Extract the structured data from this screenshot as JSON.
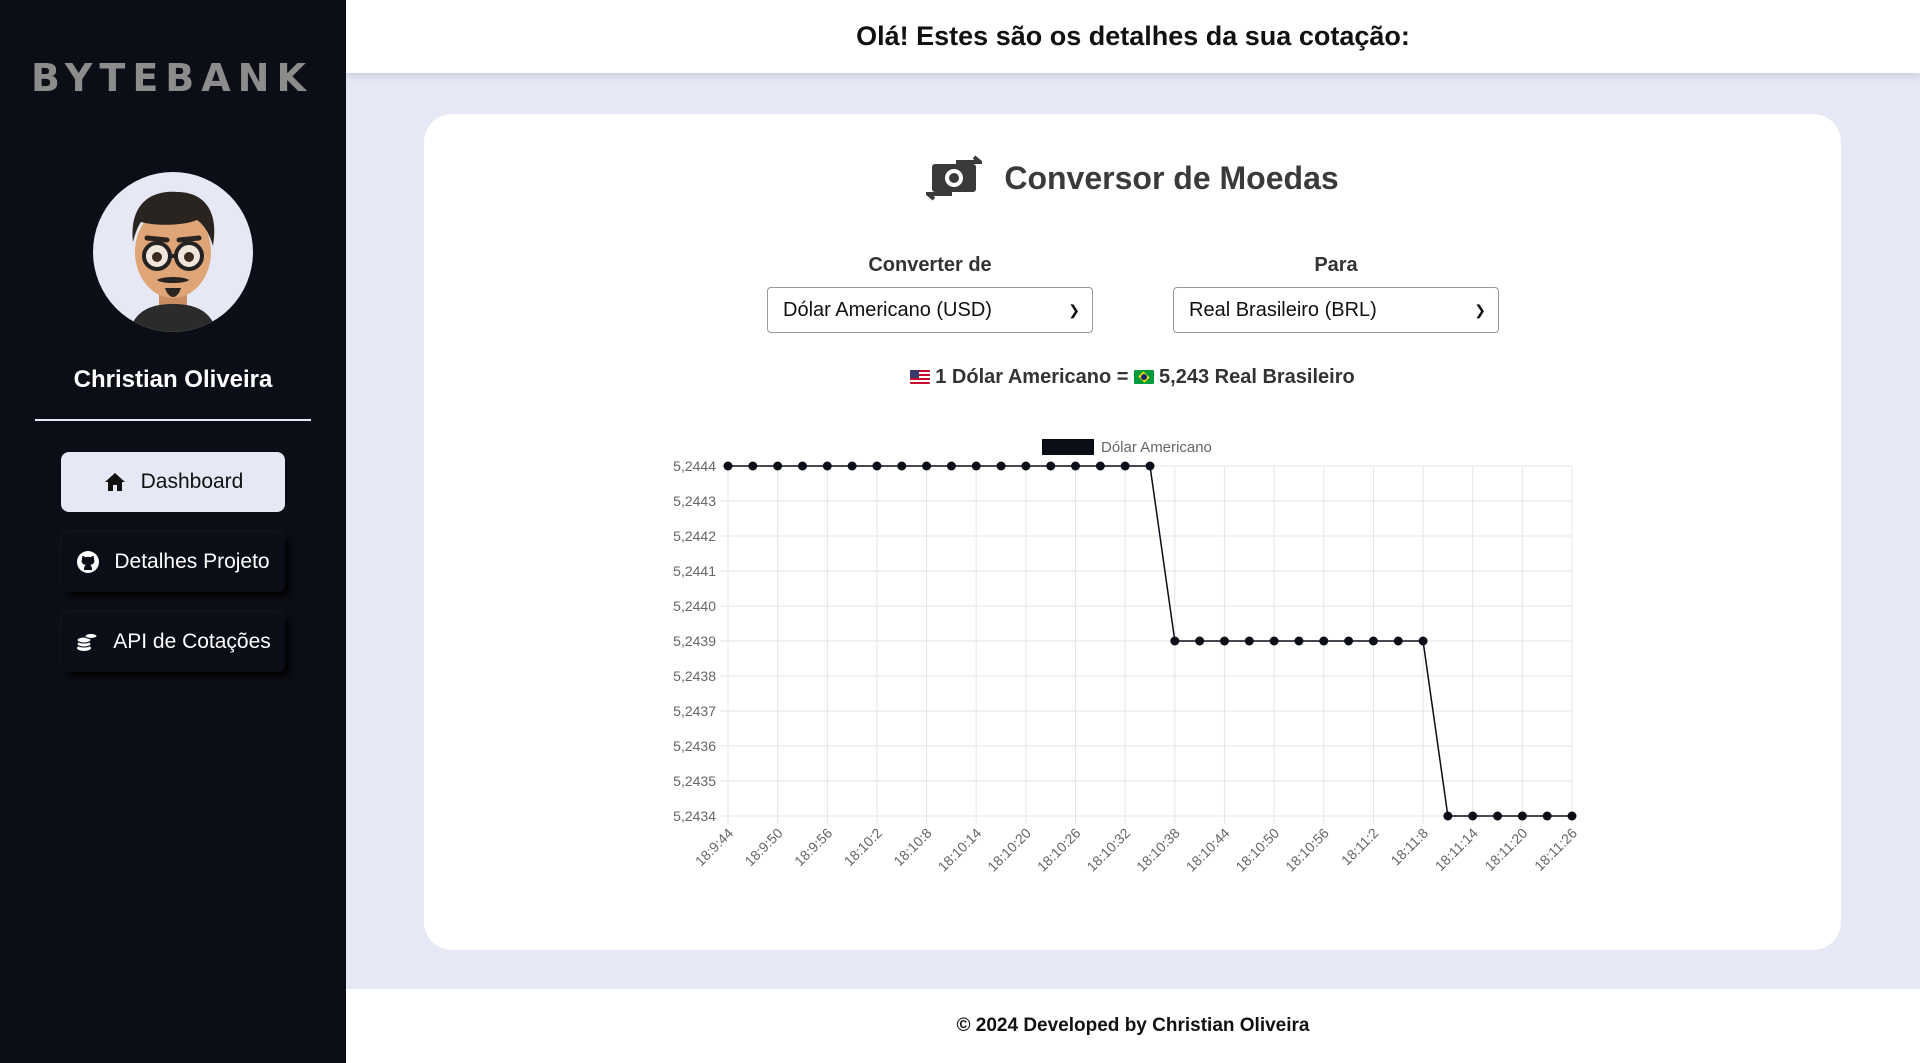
{
  "sidebar": {
    "logo_text": "BYTEBANK",
    "user_name": "Christian Oliveira",
    "nav": [
      {
        "label": "Dashboard",
        "icon": "home-icon"
      },
      {
        "label": "Detalhes Projeto",
        "icon": "github-icon"
      },
      {
        "label": "API de Cotações",
        "icon": "coins-icon"
      }
    ]
  },
  "header": {
    "title": "Olá! Estes são os detalhes da sua cotação:"
  },
  "converter": {
    "title": "Conversor de Moedas",
    "from_label": "Converter de",
    "from_value": "Dólar Americano (USD)",
    "to_label": "Para",
    "to_value": "Real Brasileiro (BRL)",
    "rate_left": "1 Dólar Americano =",
    "rate_right": "5,243 Real Brasileiro"
  },
  "chart_data": {
    "type": "line",
    "legend": "Dólar Americano",
    "legend_placement": "top-center",
    "grid": true,
    "ylim": [
      5.2434,
      5.2444
    ],
    "y_ticks": [
      "5,2444",
      "5,2443",
      "5,2442",
      "5,2441",
      "5,2440",
      "5,2439",
      "5,2438",
      "5,2437",
      "5,2436",
      "5,2435",
      "5,2434"
    ],
    "x_ticks": [
      "18:9:44",
      "18:9:50",
      "18:9:56",
      "18:10:2",
      "18:10:8",
      "18:10:14",
      "18:10:20",
      "18:10:26",
      "18:10:32",
      "18:10:38",
      "18:10:44",
      "18:10:50",
      "18:10:56",
      "18:11:2",
      "18:11:8",
      "18:11:14",
      "18:11:20",
      "18:11:26"
    ],
    "values": [
      5.2444,
      5.2444,
      5.2444,
      5.2444,
      5.2444,
      5.2444,
      5.2444,
      5.2444,
      5.2444,
      5.2444,
      5.2444,
      5.2444,
      5.2444,
      5.2444,
      5.2444,
      5.2444,
      5.2444,
      5.2444,
      5.2439,
      5.2439,
      5.2439,
      5.2439,
      5.2439,
      5.2439,
      5.2439,
      5.2439,
      5.2439,
      5.2439,
      5.2439,
      5.2434,
      5.2434,
      5.2434,
      5.2434,
      5.2434,
      5.2434
    ],
    "color": "#0b0d17"
  },
  "footer": {
    "text": "© 2024 Developed by Christian Oliveira"
  },
  "colors": {
    "sidebar": "#0b0d17",
    "background": "#e6e9f5",
    "card": "#ffffff"
  }
}
